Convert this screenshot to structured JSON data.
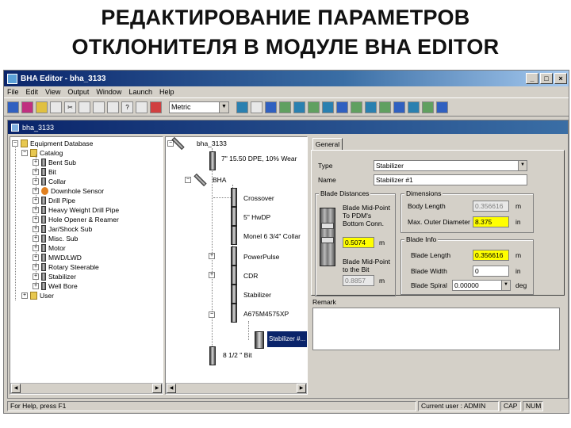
{
  "slide": {
    "title_line1": "РЕДАКТИРОВАНИЕ ПАРАМЕТРОВ",
    "title_line2": "ОТКЛОНИТЕЛЯ В МОДУЛЕ BHA EDITOR"
  },
  "window": {
    "title": "BHA Editor - bha_3133",
    "min": "_",
    "max": "□",
    "close": "×"
  },
  "menu": [
    "File",
    "Edit",
    "View",
    "Output",
    "Window",
    "Launch",
    "Help"
  ],
  "toolbar": {
    "units_value": "Metric"
  },
  "child_window": {
    "title": "bha_3133"
  },
  "tree": {
    "root": "Equipment Database",
    "catalog": "Catalog",
    "items": [
      "Bent Sub",
      "Bit",
      "Collar",
      "Downhole Sensor",
      "Drill Pipe",
      "Heavy Weight Drill Pipe",
      "Hole Opener & Reamer",
      "Jar/Shock Sub",
      "Misc. Sub",
      "Motor",
      "MWD/LWD",
      "Rotary Steerable",
      "Stabilizer",
      "Well Bore"
    ],
    "user": "User"
  },
  "assembly": {
    "root": "bha_3133",
    "items": [
      "7\" 15.50 DPE, 10% Wear",
      "BHA",
      "Crossover",
      "5\" HwDP",
      "Monel 6 3/4\" Collar",
      "PowerPulse",
      "CDR",
      "Stabilizer",
      "A675M4575XP"
    ],
    "selected": "Stabilizer #...",
    "bit": "8 1/2 \" Bit"
  },
  "general": {
    "tab": "General",
    "type_label": "Type",
    "type_value": "Stabilizer",
    "name_label": "Name",
    "name_value": "Stabilizer #1",
    "blade_distances": {
      "title": "Blade Distances",
      "mid_point_label": "Blade Mid-Point To PDM's Bottom Conn.",
      "mid_point_value": "0.5074",
      "mid_point_unit": "m",
      "mid_bit_label": "Blade Mid-Point to the Bit",
      "mid_bit_value": "0.8857",
      "mid_bit_unit": "m"
    },
    "dimensions": {
      "title": "Dimensions",
      "body_length_label": "Body Length",
      "body_length_value": "0.356616",
      "body_length_unit": "m",
      "max_od_label": "Max. Outer Diameter",
      "max_od_value": "8.375",
      "max_od_unit": "in"
    },
    "blade_info": {
      "title": "Blade Info",
      "length_label": "Blade Length",
      "length_value": "0.356616",
      "length_unit": "m",
      "width_label": "Blade Width",
      "width_value": "0",
      "width_unit": "in",
      "spiral_label": "Blade Spiral",
      "spiral_value": "0.00000",
      "spiral_unit": "deg"
    },
    "remark_label": "Remark"
  },
  "status": {
    "help": "For Help, press F1",
    "user": "Current user : ADMIN",
    "cap": "CAP",
    "num": "NUM"
  }
}
